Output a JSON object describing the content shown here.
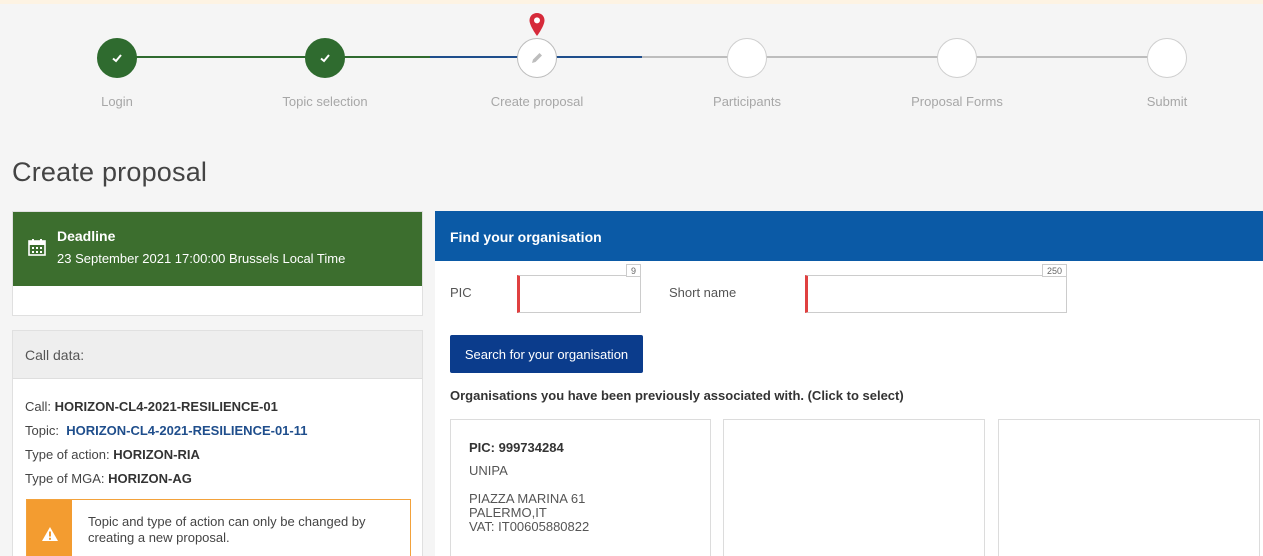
{
  "stepper": {
    "steps": [
      {
        "label": "Login",
        "state": "done"
      },
      {
        "label": "Topic selection",
        "state": "done"
      },
      {
        "label": "Create proposal",
        "state": "current"
      },
      {
        "label": "Participants",
        "state": "todo"
      },
      {
        "label": "Proposal Forms",
        "state": "todo"
      },
      {
        "label": "Submit",
        "state": "todo"
      }
    ],
    "current_marker_icon": "map-pin-icon",
    "done_icon": "checkmark-icon",
    "current_icon": "pencil-icon"
  },
  "page": {
    "title": "Create proposal"
  },
  "deadline": {
    "icon": "calendar-icon",
    "title": "Deadline",
    "text": "23 September 2021 17:00:00 Brussels Local Time"
  },
  "call_data": {
    "header": "Call data:",
    "call_label": "Call:",
    "call_value": "HORIZON-CL4-2021-RESILIENCE-01",
    "topic_label": "Topic:",
    "topic_value": "HORIZON-CL4-2021-RESILIENCE-01-11",
    "action_label": "Type of action:",
    "action_value": "HORIZON-RIA",
    "mga_label": "Type of MGA:",
    "mga_value": "HORIZON-AG",
    "warning_icon": "warning-icon",
    "warning": "Topic and type of action can only be changed by creating a new proposal."
  },
  "find_org": {
    "header": "Find your organisation",
    "pic_label": "PIC",
    "pic_value": "",
    "pic_max": "9",
    "short_name_label": "Short name",
    "short_name_value": "",
    "short_name_max": "250",
    "search_button": "Search for your organisation",
    "associated_note": "Organisations you have been previously associated with. (Click to select)",
    "organisations": [
      {
        "pic": "PIC: 999734284",
        "name": "UNIPA",
        "address": "PIAZZA MARINA 61",
        "city": "PALERMO,IT",
        "vat": "VAT: IT00605880822"
      }
    ]
  },
  "colors": {
    "done_green": "#2f6b2f",
    "deadline_green": "#3c6e2e",
    "header_blue": "#0b5aa6",
    "button_blue": "#0b3c8c",
    "progress_blue": "#1f4e8c",
    "required_red": "#e04040",
    "warning_orange": "#f39c30",
    "pin_red": "#d62a3a"
  }
}
